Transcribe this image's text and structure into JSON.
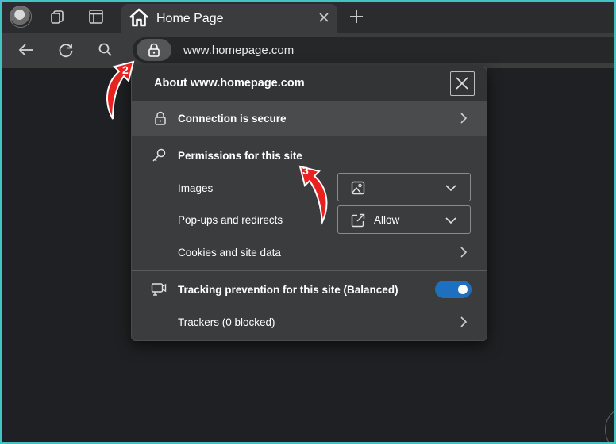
{
  "tab": {
    "title": "Home Page"
  },
  "address": {
    "url": "www.homepage.com"
  },
  "popup": {
    "title": "About www.homepage.com",
    "connection_label": "Connection is secure",
    "permissions_title": "Permissions for this site",
    "images_label": "Images",
    "images_value": "",
    "popups_label": "Pop-ups and redirects",
    "popups_value": "Allow",
    "cookies_label": "Cookies and site data",
    "tracking_label": "Tracking prevention for this site (Balanced)",
    "tracking_enabled": true,
    "trackers_label": "Trackers (0 blocked)"
  },
  "annotations": {
    "step2": "2",
    "step3": "3"
  },
  "colors": {
    "accent": "#1f6fbf",
    "annotation": "#e8231f",
    "frame": "#46c1c6"
  },
  "icons": [
    "avatar",
    "workspaces-icon",
    "tab-actions-icon",
    "home-icon",
    "close-icon",
    "new-tab-icon",
    "back-icon",
    "refresh-icon",
    "search-icon",
    "lock-icon",
    "key-icon",
    "image-icon",
    "external-link-icon",
    "tracking-icon",
    "chevron-right-icon",
    "chevron-down-icon"
  ]
}
